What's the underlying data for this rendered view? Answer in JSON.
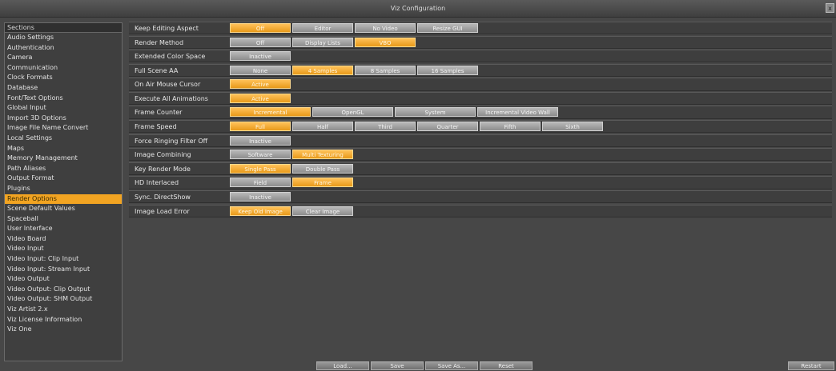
{
  "window": {
    "title": "Viz Configuration",
    "close_glyph": "x"
  },
  "sidebar": {
    "header": "Sections",
    "items": [
      {
        "label": "Audio Settings"
      },
      {
        "label": "Authentication"
      },
      {
        "label": "Camera"
      },
      {
        "label": "Communication"
      },
      {
        "label": "Clock Formats"
      },
      {
        "label": "Database"
      },
      {
        "label": "Font/Text Options"
      },
      {
        "label": "Global Input"
      },
      {
        "label": "Import 3D Options"
      },
      {
        "label": "Image File Name Convert"
      },
      {
        "label": "Local Settings"
      },
      {
        "label": "Maps"
      },
      {
        "label": "Memory Management"
      },
      {
        "label": "Path Aliases"
      },
      {
        "label": "Output Format"
      },
      {
        "label": "Plugins"
      },
      {
        "label": "Render Options",
        "selected": true
      },
      {
        "label": "Scene Default Values"
      },
      {
        "label": "Spaceball"
      },
      {
        "label": "User Interface"
      },
      {
        "label": "Video Board"
      },
      {
        "label": "Video Input"
      },
      {
        "label": "Video Input: Clip Input"
      },
      {
        "label": "Video Input: Stream Input"
      },
      {
        "label": "Video Output"
      },
      {
        "label": "Video Output: Clip Output"
      },
      {
        "label": "Video Output: SHM Output"
      },
      {
        "label": "Viz Artist 2.x"
      },
      {
        "label": "Viz License Information"
      },
      {
        "label": "Viz One"
      }
    ]
  },
  "settings": [
    {
      "label": "Keep Editing Aspect",
      "options": [
        {
          "text": "Off",
          "w": 76,
          "sel": true
        },
        {
          "text": "Editor",
          "w": 76
        },
        {
          "text": "No Video",
          "w": 76
        },
        {
          "text": "Resize GUI",
          "w": 76
        }
      ]
    },
    {
      "label": "Render Method",
      "options": [
        {
          "text": "Off",
          "w": 76
        },
        {
          "text": "Display Lists",
          "w": 76
        },
        {
          "text": "VBO",
          "w": 76,
          "sel": true
        }
      ]
    },
    {
      "label": "Extended Color Space",
      "options": [
        {
          "text": "Inactive",
          "w": 76
        }
      ]
    },
    {
      "label": "Full Scene AA",
      "options": [
        {
          "text": "None",
          "w": 76
        },
        {
          "text": "4 Samples",
          "w": 76,
          "sel": true
        },
        {
          "text": "8 Samples",
          "w": 76
        },
        {
          "text": "16 Samples",
          "w": 76
        }
      ]
    },
    {
      "label": "On Air Mouse Cursor",
      "options": [
        {
          "text": "Active",
          "w": 76,
          "sel": true
        }
      ]
    },
    {
      "label": "Execute All Animations",
      "options": [
        {
          "text": "Active",
          "w": 76,
          "sel": true
        }
      ]
    },
    {
      "label": "Frame Counter",
      "options": [
        {
          "text": "Incremental",
          "w": 101,
          "sel": true
        },
        {
          "text": "OpenGL",
          "w": 101
        },
        {
          "text": "System",
          "w": 101
        },
        {
          "text": "Incremental Video Wall",
          "w": 101
        }
      ]
    },
    {
      "label": "Frame Speed",
      "options": [
        {
          "text": "Full",
          "w": 76,
          "sel": true
        },
        {
          "text": "Half",
          "w": 76
        },
        {
          "text": "Third",
          "w": 76
        },
        {
          "text": "Quarter",
          "w": 76
        },
        {
          "text": "Fifth",
          "w": 76
        },
        {
          "text": "Sixth",
          "w": 76
        }
      ]
    },
    {
      "label": "Force Ringing Filter Off",
      "options": [
        {
          "text": "Inactive",
          "w": 76
        }
      ]
    },
    {
      "label": "Image Combining",
      "options": [
        {
          "text": "Software",
          "w": 76
        },
        {
          "text": "Multi Texturing",
          "w": 76,
          "sel": true
        }
      ]
    },
    {
      "label": "Key Render Mode",
      "options": [
        {
          "text": "Single Pass",
          "w": 76,
          "sel": true
        },
        {
          "text": "Double Pass",
          "w": 76
        }
      ]
    },
    {
      "label": "HD Interlaced",
      "options": [
        {
          "text": "Field",
          "w": 76
        },
        {
          "text": "Frame",
          "w": 76,
          "sel": true
        }
      ]
    },
    {
      "label": "Sync. DirectShow",
      "options": [
        {
          "text": "Inactive",
          "w": 76
        }
      ]
    },
    {
      "label": "Image Load Error",
      "options": [
        {
          "text": "Keep Old Image",
          "w": 76,
          "sel": true
        },
        {
          "text": "Clear Image",
          "w": 76
        }
      ]
    }
  ],
  "footer": {
    "load": "Load...",
    "save": "Save",
    "save_as": "Save As...",
    "reset": "Reset",
    "restart": "Restart"
  }
}
